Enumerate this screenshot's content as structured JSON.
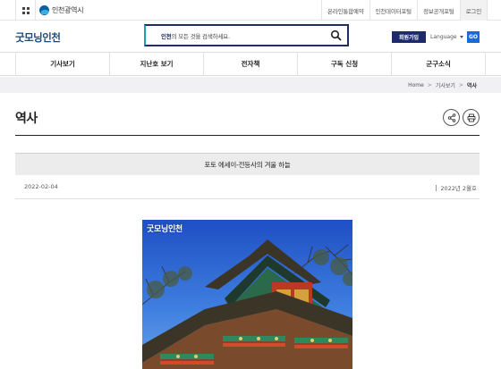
{
  "topbar": {
    "city_name": "인천광역시",
    "links": [
      "온라인통합예약",
      "인천데이터포털",
      "정보공개포털",
      "로그인"
    ]
  },
  "header": {
    "site_logo": "굿모닝인천",
    "search_placeholder_bold": "인천",
    "search_placeholder_rest": "의 모든 것을 검색하세요.",
    "join_label": "회원가입",
    "language_label": "Language",
    "go_label": "GO"
  },
  "gnb": [
    "기사보기",
    "지난호 보기",
    "전자책",
    "구독 신청",
    "군구소식"
  ],
  "breadcrumb": {
    "home": "Home",
    "sep": ">",
    "section": "기사보기",
    "current": "역사"
  },
  "page": {
    "title": "역사"
  },
  "article": {
    "title": "포토 에세이-전등사의 겨울 하늘",
    "date": "2022-02-04",
    "issue": "2022년 2월호"
  },
  "photo": {
    "overlay_logo": "굿모닝인천"
  },
  "colors": {
    "brand_navy": "#1d2f60",
    "brand_teal": "#1b9fb5",
    "go_blue": "#1a6ad8"
  }
}
